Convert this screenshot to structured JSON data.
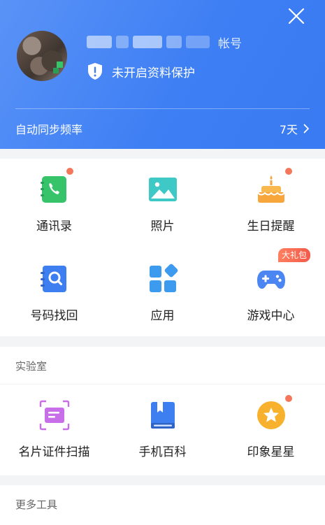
{
  "header": {
    "account_suffix": "帐号",
    "protection_label": "未开启资料保护",
    "sync_label": "自动同步频率",
    "sync_value": "7天"
  },
  "main_grid": {
    "items": [
      {
        "label": "通讯录",
        "icon": "contacts-icon"
      },
      {
        "label": "照片",
        "icon": "photos-icon"
      },
      {
        "label": "生日提醒",
        "icon": "birthday-cake-icon"
      },
      {
        "label": "号码找回",
        "icon": "number-recovery-icon"
      },
      {
        "label": "应用",
        "icon": "apps-icon"
      },
      {
        "label": "游戏中心",
        "icon": "gamepad-icon",
        "badge": "大礼包"
      }
    ]
  },
  "lab": {
    "title": "实验室",
    "items": [
      {
        "label": "名片证件扫描",
        "icon": "card-scan-icon"
      },
      {
        "label": "手机百科",
        "icon": "encyclopedia-book-icon"
      },
      {
        "label": "印象星星",
        "icon": "star-badge-icon"
      }
    ]
  },
  "more_tools": {
    "title": "更多工具"
  },
  "colors": {
    "header_blue": "#3e7ff4",
    "accent_red_dot": "#f4775b",
    "green": "#36c36a",
    "teal": "#3ec9c6",
    "orange": "#f7a63b",
    "blue_icon": "#3d7ef0",
    "purple": "#c86ee8"
  }
}
